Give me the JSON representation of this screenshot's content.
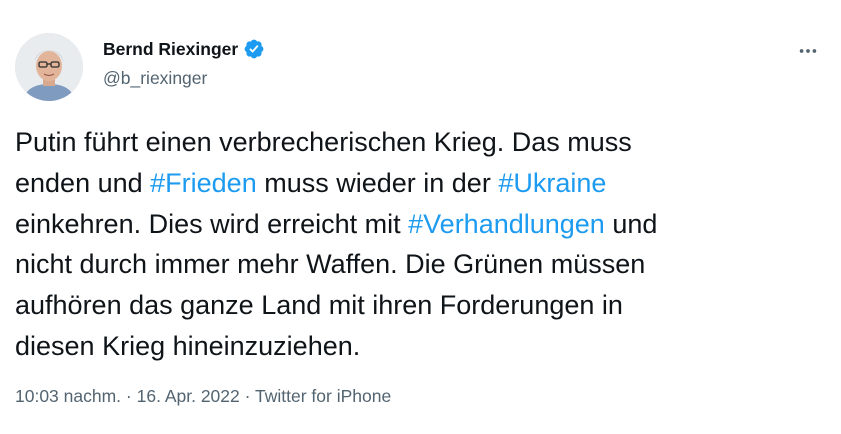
{
  "tweet": {
    "author": {
      "name": "Bernd Riexinger",
      "handle": "@b_riexinger",
      "verified": true
    },
    "body": {
      "line1": "Putin führt einen verbrecherischen Krieg. Das muss",
      "line2_a": "enden und ",
      "hashtag_frieden": "#Frieden",
      "line2_b": " muss wieder in der ",
      "hashtag_ukraine": "#Ukraine",
      "line3_a": "einkehren. Dies wird erreicht mit ",
      "hashtag_verhandlungen": "#Verhandlungen",
      "line3_b": " und",
      "line4": "nicht durch immer mehr Waffen. Die Grünen müssen",
      "line5": "aufhören das ganze Land mit ihren Forderungen in",
      "line6": "diesen Krieg hineinzuziehen."
    },
    "meta": {
      "time": "10:03 nachm.",
      "separator": " · ",
      "date": "16. Apr. 2022",
      "source": "Twitter for iPhone"
    }
  },
  "colors": {
    "accent": "#1d9bf0",
    "text": "#0f1419",
    "secondary": "#536471"
  },
  "icons": {
    "verified": "verified-badge-icon",
    "more": "more-options-icon"
  }
}
